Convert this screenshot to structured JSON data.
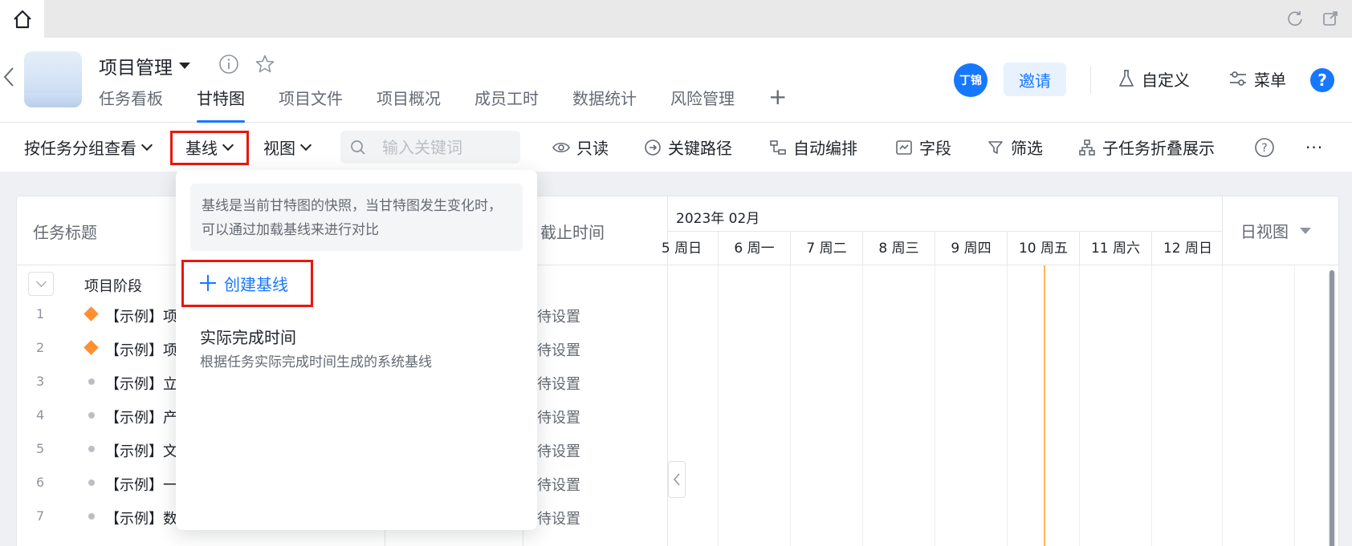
{
  "header": {
    "project_title": "项目管理",
    "tabs": [
      {
        "label": "任务看板"
      },
      {
        "label": "甘特图"
      },
      {
        "label": "项目文件"
      },
      {
        "label": "项目概况"
      },
      {
        "label": "成员工时"
      },
      {
        "label": "数据统计"
      },
      {
        "label": "风险管理"
      }
    ],
    "active_tab": "甘特图",
    "avatar_text": "丁锦",
    "invite_label": "邀请",
    "customize_label": "自定义",
    "menu_label": "菜单",
    "help_label": "?"
  },
  "toolbar": {
    "group_by": "按任务分组查看",
    "baseline": "基线",
    "view": "视图",
    "search_placeholder": "输入关键词",
    "readonly": "只读",
    "critical_path": "关键路径",
    "auto_schedule": "自动编排",
    "fields": "字段",
    "filter": "筛选",
    "subtask_fold": "子任务折叠展示",
    "help": "?",
    "more": "···"
  },
  "table": {
    "col_title": "任务标题",
    "col_deadline": "截止时间",
    "group_label": "项目阶段",
    "rows": [
      {
        "num": "1",
        "name": "【示例】项",
        "date": "待设置",
        "marker": "diamond"
      },
      {
        "num": "2",
        "name": "【示例】项",
        "date": "待设置",
        "marker": "diamond"
      },
      {
        "num": "3",
        "name": "【示例】立",
        "date": "待设置",
        "marker": "dot"
      },
      {
        "num": "4",
        "name": "【示例】产",
        "date": "待设置",
        "marker": "dot"
      },
      {
        "num": "5",
        "name": "【示例】文",
        "date": "待设置",
        "marker": "dot"
      },
      {
        "num": "6",
        "name": "【示例】一",
        "date": "待设置",
        "marker": "dot"
      },
      {
        "num": "7",
        "name": "【示例】数",
        "date": "待设置",
        "marker": "dot"
      }
    ]
  },
  "gantt": {
    "month": "2023年 02月",
    "days": [
      "5 周日",
      "6 周一",
      "7 周二",
      "8 周三",
      "9 周四",
      "10 周五",
      "11 周六",
      "12 周日"
    ],
    "view_mode": "日视图"
  },
  "baseline_popover": {
    "description": "基线是当前甘特图的快照，当甘特图发生变化时，可以通过加载基线来进行对比",
    "create_label": "创建基线",
    "option_title": "实际完成时间",
    "option_desc": "根据任务实际完成时间生成的系统基线"
  },
  "colors": {
    "accent": "#1677ff",
    "highlight_box": "#e8170f",
    "milestone": "#ff8f2f",
    "today_line": "#ffb65c"
  }
}
